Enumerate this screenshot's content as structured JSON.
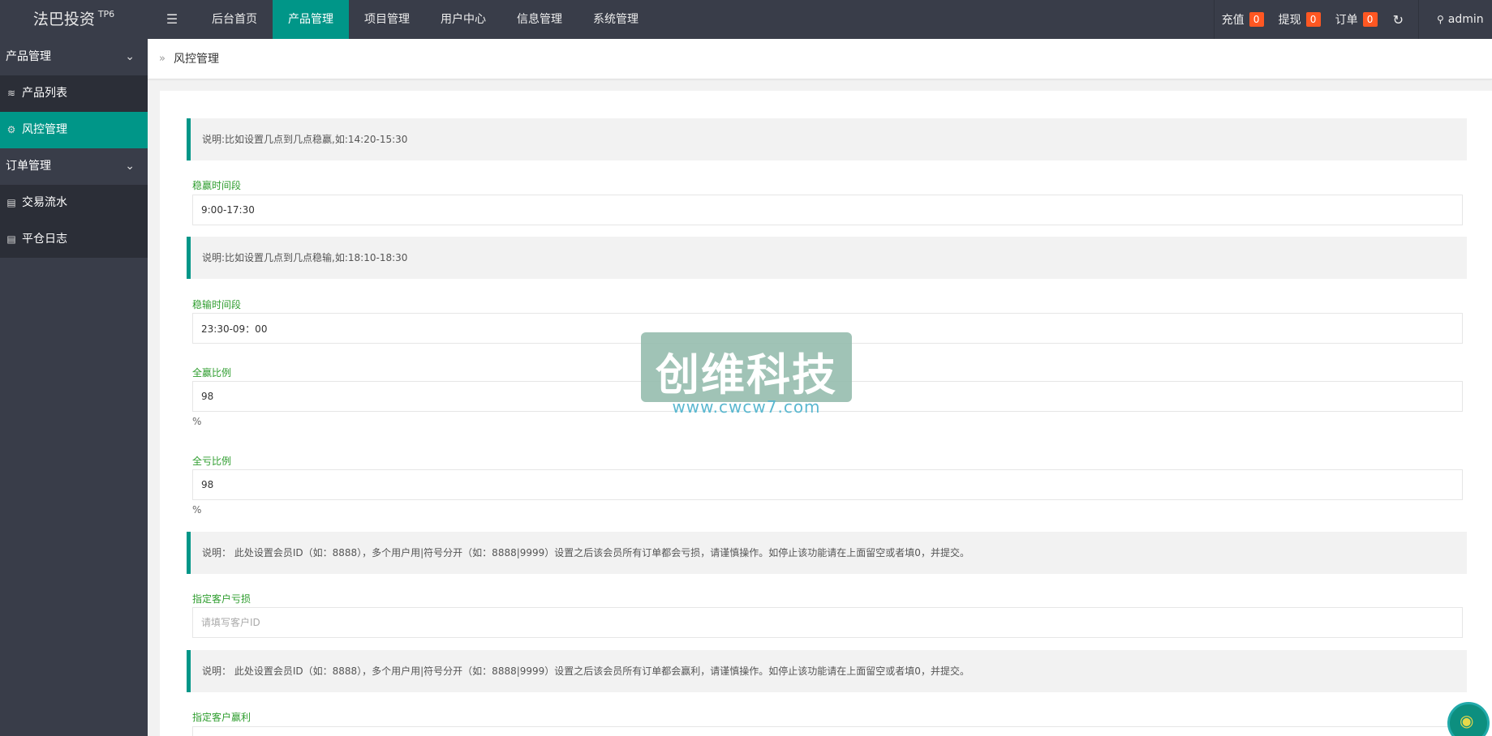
{
  "header": {
    "logo": "法巴投资",
    "logo_sup": "TP6",
    "toggle_icon": "☰",
    "nav": [
      {
        "label": "后台首页",
        "active": false
      },
      {
        "label": "产品管理",
        "active": true
      },
      {
        "label": "项目管理",
        "active": false
      },
      {
        "label": "用户中心",
        "active": false
      },
      {
        "label": "信息管理",
        "active": false
      },
      {
        "label": "系统管理",
        "active": false
      }
    ],
    "recharge_label": "充值",
    "recharge_count": "0",
    "withdraw_label": "提现",
    "withdraw_count": "0",
    "order_label": "订单",
    "order_count": "0",
    "refresh_icon": "↻",
    "user_icon": "⚲",
    "user_label": "admin"
  },
  "sidebar": {
    "group1": "产品管理",
    "group1_chev": "⌄",
    "item_product_list": "产品列表",
    "item_risk": "风控管理",
    "group2": "订单管理",
    "group2_chev": "⌄",
    "item_trade": "交易流水",
    "item_close_log": "平仓日志"
  },
  "breadcrumb": {
    "arrow": "»",
    "label": "风控管理"
  },
  "form": {
    "note1": "说明:比如设置几点到几点稳赢,如:14:20-15:30",
    "win_period_label": "稳赢时间段",
    "win_period_value": "9:00-17:30",
    "note2": "说明:比如设置几点到几点稳输,如:18:10-18:30",
    "lose_period_label": "稳输时间段",
    "lose_period_value": "23:30-09：00",
    "full_win_label": "全赢比例",
    "full_win_value": "98",
    "full_win_unit": "%",
    "full_lose_label": "全亏比例",
    "full_lose_value": "98",
    "full_lose_unit": "%",
    "note3": "说明： 此处设置会员ID（如：8888），多个用户用|符号分开（如：8888|9999）设置之后该会员所有订单都会亏损，请谨慎操作。如停止该功能请在上面留空或者填0，并提交。",
    "loss_customer_label": "指定客户亏损",
    "loss_customer_placeholder": "请填写客户ID",
    "note4": "说明： 此处设置会员ID（如：8888），多个用户用|符号分开（如：8888|9999）设置之后该会员所有订单都会赢利，请谨慎操作。如停止该功能请在上面留空或者填0，并提交。",
    "win_customer_label": "指定客户赢利"
  },
  "watermark": {
    "text": "创维科技",
    "url": "www.cwcw7.com"
  }
}
